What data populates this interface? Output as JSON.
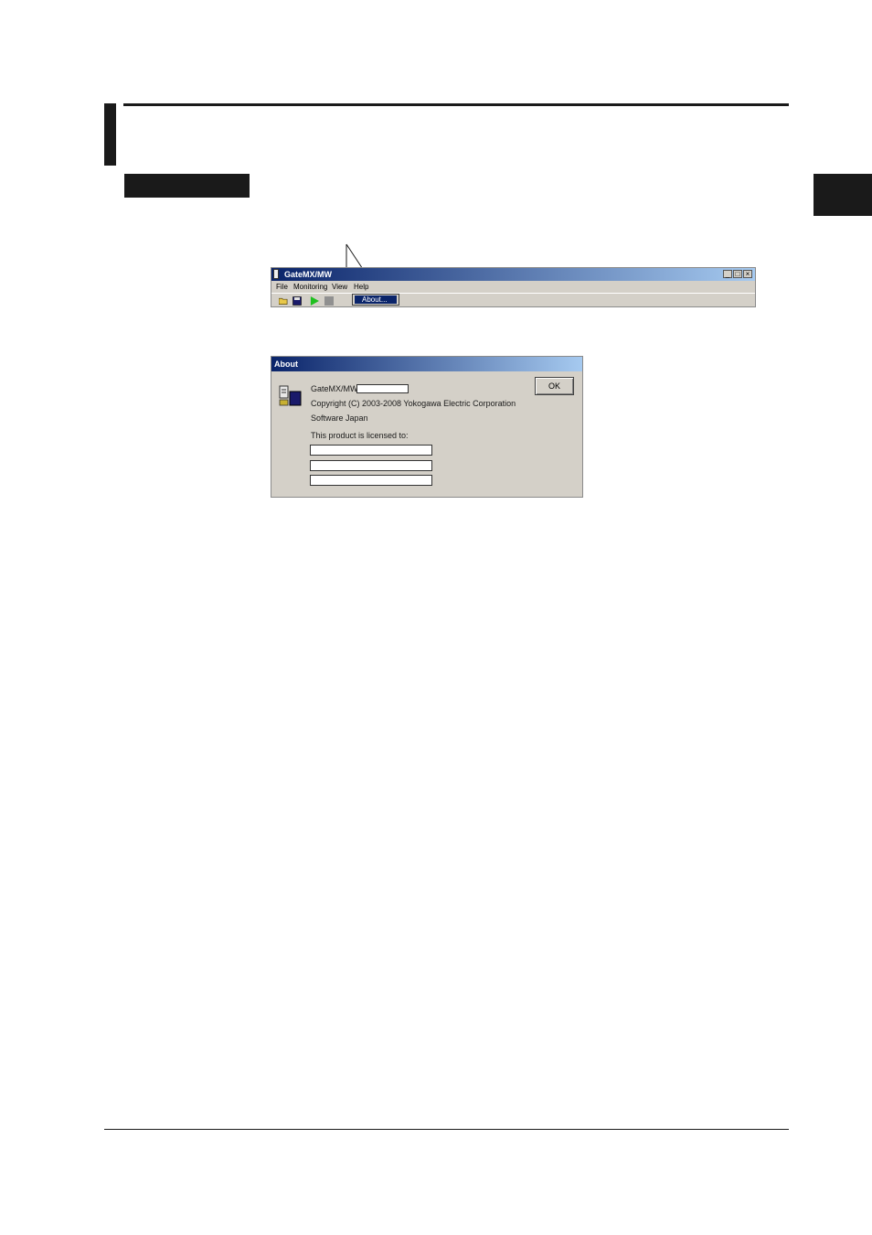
{
  "main_window": {
    "title": "GateMX/MW",
    "menu": [
      "File",
      "Monitoring",
      "View",
      "Help"
    ],
    "help_menu_item": "About...",
    "window_buttons": [
      "_",
      "□",
      "×"
    ]
  },
  "about_dialog": {
    "title": "About",
    "product": "GateMX/MW",
    "copyright": "Copyright (C) 2003-2008 Yokogawa Electric Corporation",
    "company": "Software Japan",
    "licensed_to": "This product is licensed to:",
    "ok_label": "OK"
  }
}
